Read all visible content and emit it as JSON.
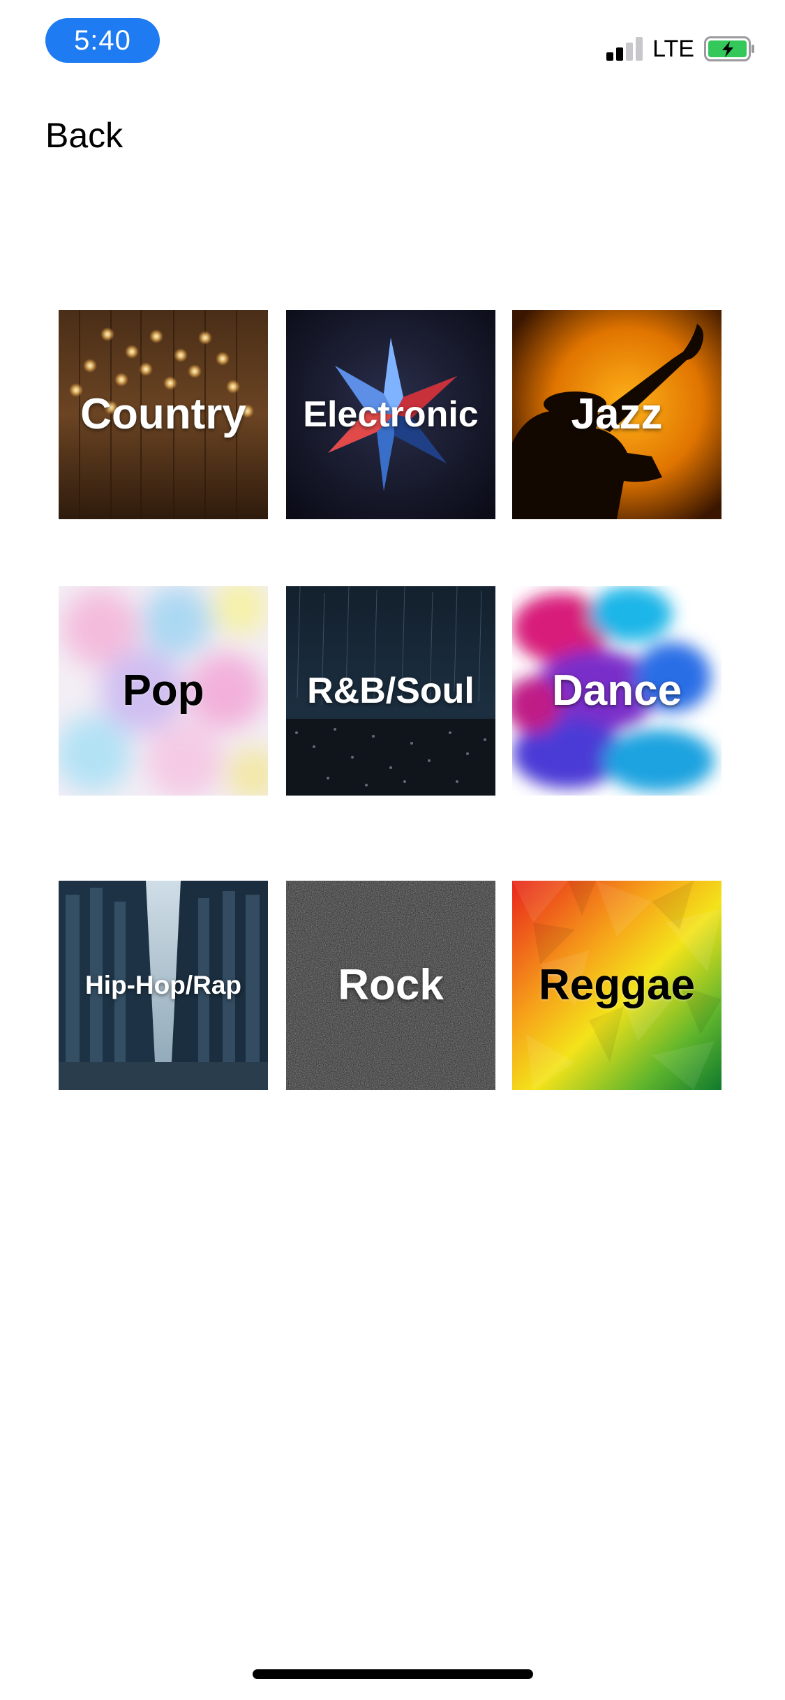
{
  "status_bar": {
    "time": "5:40",
    "network": "LTE",
    "pill_color": "#1e7bf2",
    "battery_color": "#34c759"
  },
  "nav": {
    "back_label": "Back"
  },
  "genres": [
    {
      "label": "Country",
      "art": "wooden-wall-string-lights"
    },
    {
      "label": "Electronic",
      "art": "abstract-crystal-star"
    },
    {
      "label": "Jazz",
      "art": "trumpet-player-silhouette"
    },
    {
      "label": "Pop",
      "art": "pastel-watercolor-clouds"
    },
    {
      "label": "R&B/Soul",
      "art": "rain-on-dark-field"
    },
    {
      "label": "Dance",
      "art": "colored-smoke-ink"
    },
    {
      "label": "Hip-Hop/Rap",
      "art": "city-street-skyscrapers"
    },
    {
      "label": "Rock",
      "art": "black-stone-texture"
    },
    {
      "label": "Reggae",
      "art": "red-yellow-green-polygons"
    }
  ]
}
